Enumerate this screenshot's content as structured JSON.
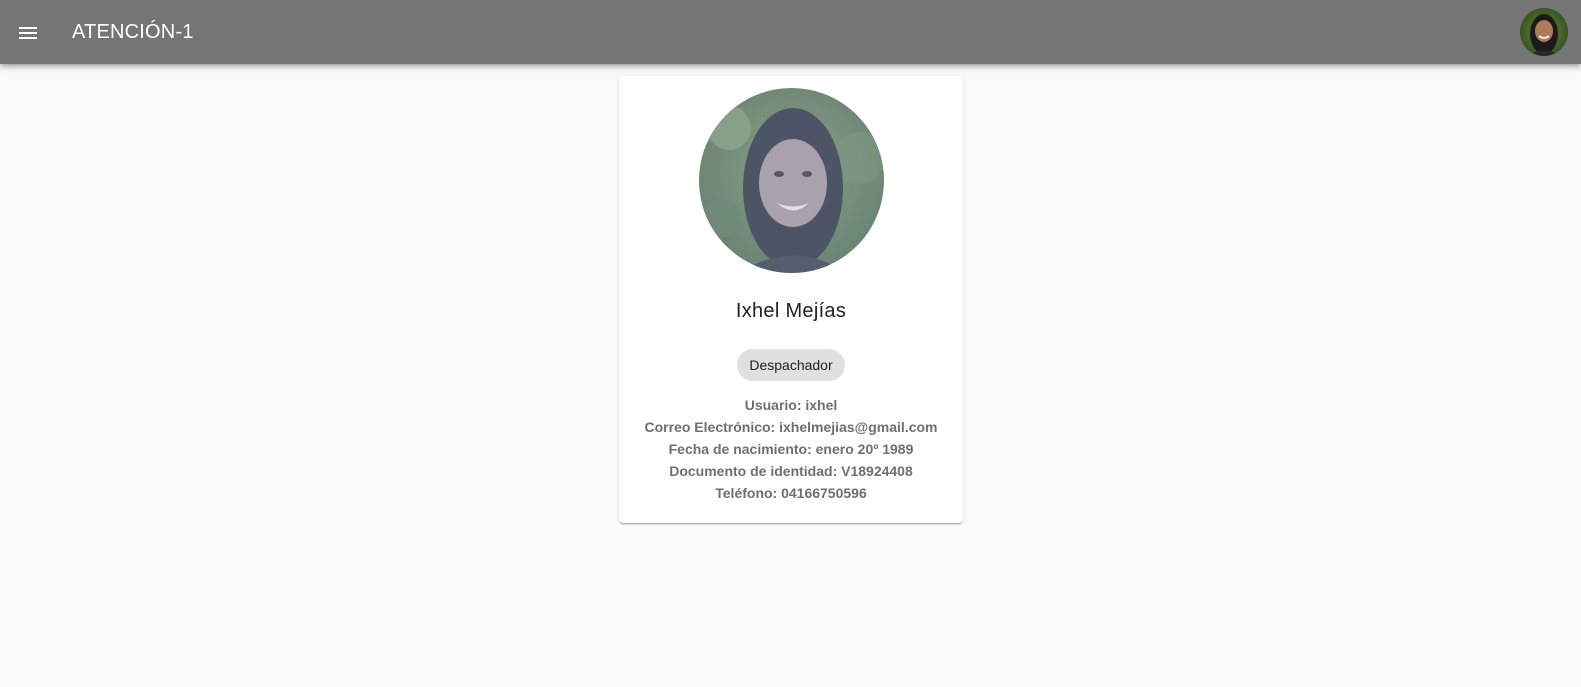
{
  "toolbar": {
    "menu_icon": "menu-icon",
    "title": "ATENCIÓN-1",
    "avatar_icon": "user-avatar",
    "background_color": "#757575"
  },
  "profile": {
    "name": "Ixhel Mejías",
    "role": "Despachador",
    "details": [
      "Usuario: ixhel",
      "Correo Electrónico: ixhelmejias@gmail.com",
      "Fecha de nacimiento: enero 20º 1989",
      "Documento de identidad: V18924408",
      "Teléfono: 04166750596"
    ]
  }
}
